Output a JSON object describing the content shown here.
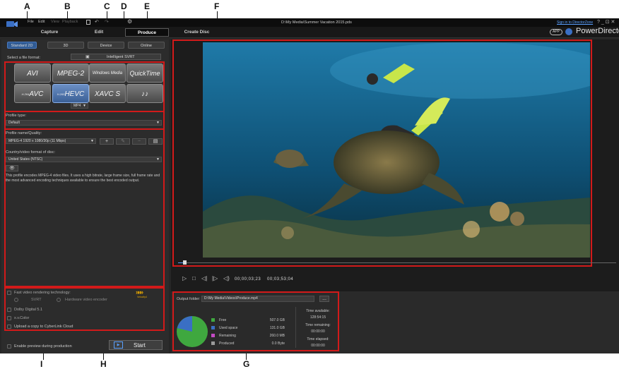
{
  "callouts": [
    "A",
    "B",
    "C",
    "D",
    "E",
    "F",
    "G",
    "H",
    "I"
  ],
  "menu": [
    "File",
    "Edit",
    "View",
    "Playback"
  ],
  "window_title": "D:\\My Media\\Summer Vacation 2015.pds",
  "sign_in": "Sign in to DirectorZone",
  "window_controls": "?  _  ⊡  ✕",
  "main_tabs": [
    "Capture",
    "Edit",
    "Produce",
    "Create Disc"
  ],
  "brand": {
    "app_badge": "APP",
    "name": "PowerDirector"
  },
  "sub_tabs": [
    "Standard 2D",
    "3D",
    "Device",
    "Online"
  ],
  "select_format_label": "Select a file format:",
  "intelligent_svrt": "Intelligent SVRT",
  "formats": [
    "AVI",
    "MPEG-2",
    "Windows Media",
    "QuickTime",
    "AVC",
    "HEVC",
    "XAVC S",
    "♪♪"
  ],
  "format_prefix": {
    "avc": "H.264",
    "hevc": "H.265"
  },
  "container_select": "MP4",
  "profile_type_label": "Profile type:",
  "profile_type_value": "Default",
  "profile_name_label": "Profile name/Quality:",
  "profile_name_value": "MPEG-4 1920 x 1080/30p (11 Mbps)",
  "country_label": "Country/video format of disc:",
  "country_value": "United States (NTSC)",
  "description": "This profile encodes MPEG-4 video files. It uses a high bitrate, large frame size, full frame rate and the most advanced encoding techniques available to ensure the best encoded output.",
  "options": {
    "fast_render": "Fast video rendering technology:",
    "svrt": "SVRT",
    "hw_encoder": "Hardware video encoder",
    "dolby": "Dolby Digital 5.1",
    "xvcolor": "x.v.Color",
    "upload": "Upload a copy to CyberLink Cloud",
    "velocity": "Velocity4"
  },
  "enable_preview": "Enable preview during production",
  "start_button": "Start",
  "timecode_current": "00;00;03;23",
  "timecode_total": "00;03;53;04",
  "output_folder_label": "Output folder:",
  "output_folder_value": "D:\\My Media\\Videos\\Produce.mp4",
  "browse_button": "...",
  "disk": [
    {
      "label": "Free",
      "value": "507.0 GB",
      "color": "#3fa83f"
    },
    {
      "label": "Used space",
      "value": "131.0 GB",
      "color": "#3a6fc4"
    },
    {
      "label": "Remaining",
      "value": "260.0 MB",
      "color": "#c44bc4"
    },
    {
      "label": "Produced",
      "value": "0.0 Byte",
      "color": "#9a9a9a"
    }
  ],
  "time_available_label": "Time available:",
  "time_available": "128:54:15",
  "time_remaining_label": "Time remaining:",
  "time_remaining": "00:00:00",
  "time_elapsed_label": "Time elapsed:",
  "time_elapsed": "00:00:00",
  "colors": {
    "highlight": "#d21a1a",
    "accent": "#3a6fc4"
  }
}
